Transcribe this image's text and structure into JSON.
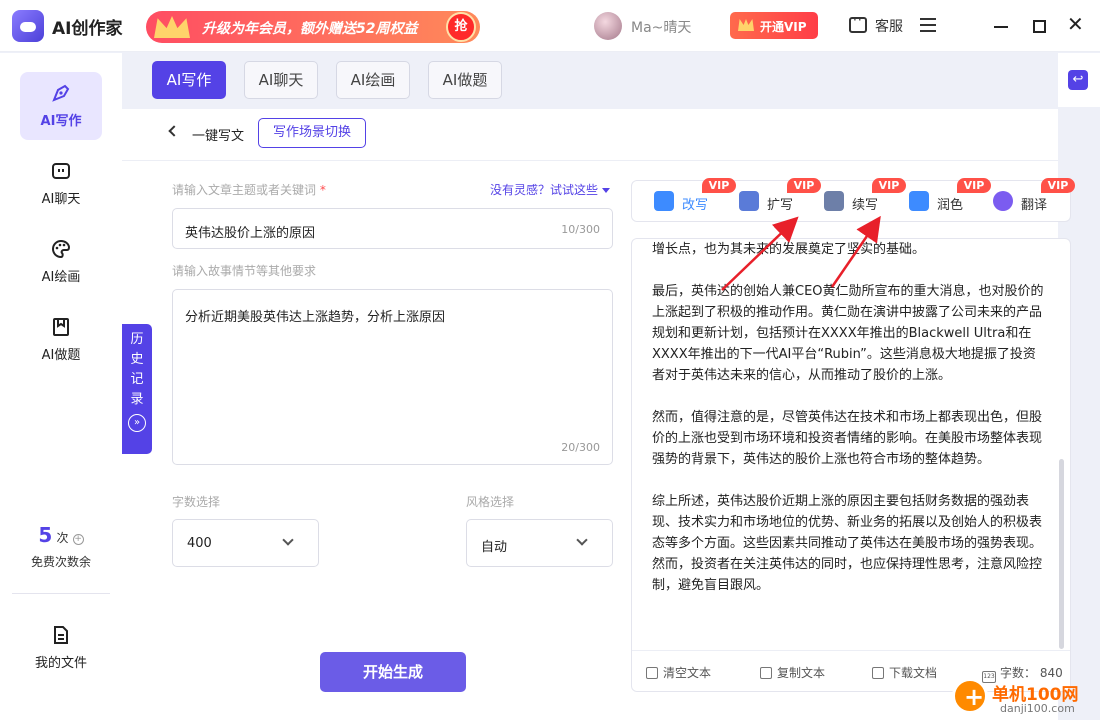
{
  "app": {
    "title": "AI创作家",
    "promo_text": "升级为年会员，额外赠送52周权益",
    "promo_badge": "抢",
    "username": "Ma~晴天",
    "vip_button": "开通VIP",
    "service": "客服"
  },
  "nav": {
    "items": [
      {
        "label": "AI写作",
        "icon": "pen-icon",
        "active": true
      },
      {
        "label": "AI聊天",
        "icon": "chat-icon",
        "active": false
      },
      {
        "label": "AI绘画",
        "icon": "palette-icon",
        "active": false
      },
      {
        "label": "AI做题",
        "icon": "bookmark-icon",
        "active": false
      }
    ],
    "credits_count": "5",
    "credits_unit": "次",
    "credits_label": "免费次数余",
    "files_label": "我的文件"
  },
  "tabs": [
    "AI写作",
    "AI聊天",
    "AI绘画",
    "AI做题"
  ],
  "breadcrumb": {
    "label": "一键写文",
    "scene_button": "写作场景切换"
  },
  "history": {
    "chars": [
      "历",
      "史",
      "记",
      "录"
    ],
    "chevron": "»"
  },
  "form": {
    "topic_label": "请输入文章主题或者关键词",
    "required_mark": "*",
    "inspiration": "没有灵感？试试这些",
    "topic_value": "英伟达股价上涨的原因",
    "topic_count": "10/300",
    "detail_label": "请输入故事情节等其他要求",
    "detail_value": "分析近期美股英伟达上涨趋势，分析上涨原因",
    "detail_count": "20/300",
    "wordcount_label": "字数选择",
    "wordcount_value": "400",
    "style_label": "风格选择",
    "style_value": "自动",
    "generate_button": "开始生成"
  },
  "tools": [
    {
      "label": "改写",
      "vip": "VIP",
      "icon": "rewrite-icon",
      "color": "#3d8bff"
    },
    {
      "label": "扩写",
      "vip": "VIP",
      "icon": "expand-icon",
      "color": "#5a7bd8"
    },
    {
      "label": "续写",
      "vip": "VIP",
      "icon": "continue-icon",
      "color": "#6d7fa8"
    },
    {
      "label": "润色",
      "vip": "VIP",
      "icon": "polish-icon",
      "color": "#3d8bff"
    },
    {
      "label": "翻译",
      "vip": "VIP",
      "icon": "translate-icon",
      "color": "#7b5cf0"
    }
  ],
  "result": {
    "paragraphs": [
      "增长点，也为其未来的发展奠定了坚实的基础。",
      "最后，英伟达的创始人兼CEO黄仁勋所宣布的重大消息，也对股价的上涨起到了积极的推动作用。黄仁勋在演讲中披露了公司未来的产品规划和更新计划，包括预计在XXXX年推出的Blackwell Ultra和在XXXX年推出的下一代AI平台“Rubin”。这些消息极大地提振了投资者对于英伟达未来的信心，从而推动了股价的上涨。",
      "然而，值得注意的是，尽管英伟达在技术和市场上都表现出色，但股价的上涨也受到市场环境和投资者情绪的影响。在美股市场整体表现强势的背景下，英伟达的股价上涨也符合市场的整体趋势。",
      "综上所述，英伟达股价近期上涨的原因主要包括财务数据的强劲表现、技术实力和市场地位的优势、新业务的拓展以及创始人的积极表态等多个方面。这些因素共同推动了英伟达在美股市场的强势表现。然而，投资者在关注英伟达的同时，也应保持理性思考，注意风险控制，避免盲目跟风。"
    ],
    "clear": "清空文本",
    "copy": "复制文本",
    "download": "下载文档",
    "wordcount_label": "字数：",
    "wordcount_value": "840"
  },
  "watermark": {
    "text": "单机100网",
    "url": "danji100.com"
  },
  "colors": {
    "accent": "#5442e6",
    "vip_red": "#ff5148",
    "annotation_arrow": "#e8202a"
  }
}
